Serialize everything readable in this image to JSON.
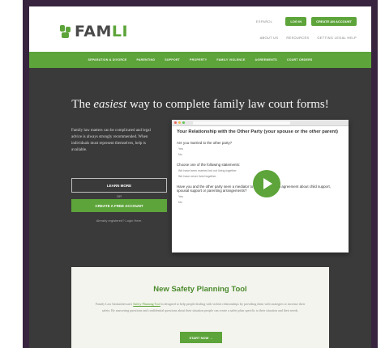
{
  "header": {
    "brand_prefix": "FAM",
    "brand_accent": "LI",
    "language": "ESPAÑOL",
    "login": "LOG IN",
    "create_account": "CREATE AN ACCOUNT",
    "links": [
      "ABOUT US",
      "RESOURCES",
      "GETTING LEGAL HELP"
    ]
  },
  "nav": {
    "items": [
      "SEPARATION & DIVORCE",
      "PARENTING",
      "SUPPORT",
      "PROPERTY",
      "FAMILY VIOLENCE",
      "AGREEMENTS",
      "COURT ORDERS"
    ]
  },
  "hero": {
    "title_before": "The ",
    "title_em": "easiest",
    "title_after": " way to complete family law court forms!",
    "left_text": "Family law matters can be complicated and legal advice is always strongly recommended. When individuals must represent themselves, help is available.",
    "learn_more": "LEARN MORE",
    "or": "OR",
    "create_free": "CREATE A FREE ACCOUNT",
    "already": "Already registered? Login Here."
  },
  "preview": {
    "heading": "Your Relationship with the Other Party (your spouse or the other parent)",
    "q1": "Are you married to the other party?",
    "q1_opts": [
      "Yes",
      "No"
    ],
    "q2": "Choose one of the following statements:",
    "q2_opts": [
      "We have been married but not living together",
      "We have never lived together"
    ],
    "q3": "Have you and the other party seen a mediator to try to come to an agreement about child support, spousal support or parenting arrangements?",
    "q3_opts": [
      "Yes",
      "No"
    ]
  },
  "safety": {
    "title": "New Safety Planning Tool",
    "text_before": "Family Law Saskatchewan's ",
    "text_link": "Safety Planning Tool",
    "text_after": " is designed to help people dealing with violent relationships by providing them with strategies to increase their safety. By answering questions and confidential questions about their situation people can create a safety plan specific to their situation and their needs.",
    "start_now": "START NOW →"
  },
  "colors": {
    "brand_green": "#5da43a",
    "frame_purple": "#38243f",
    "hero_bg": "#3a3a3a"
  }
}
